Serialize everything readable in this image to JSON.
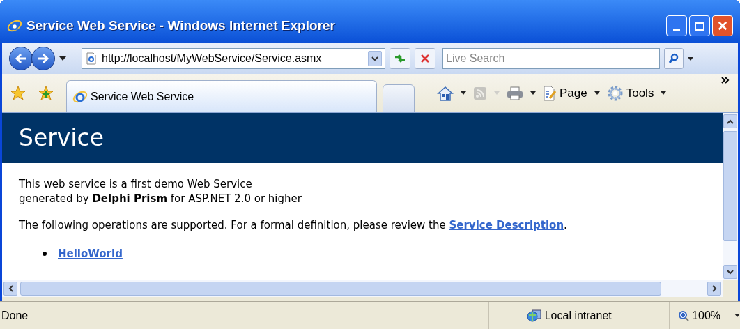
{
  "window": {
    "title": "Service Web Service - Windows Internet Explorer"
  },
  "address": {
    "url": "http://localhost/MyWebService/Service.asmx"
  },
  "search": {
    "placeholder": "Live Search"
  },
  "tabs": [
    {
      "label": "Service Web Service",
      "selected": true
    }
  ],
  "toolbar": [
    {
      "kind": "home",
      "disabled": false
    },
    {
      "kind": "feeds",
      "disabled": true
    },
    {
      "kind": "print",
      "disabled": false
    },
    {
      "kind": "page",
      "label": "Page",
      "disabled": false
    },
    {
      "kind": "tools",
      "label": "Tools",
      "disabled": false
    }
  ],
  "page": {
    "heading": "Service",
    "intro": [
      "This web service is a first demo Web Service",
      "generated by **Delphi Prism** for ASP.NET 2.0 or higher"
    ],
    "operations_text": "The following operations are supported. For a formal definition, please review the",
    "description_link": "Service Description",
    "operations_end": ".",
    "operations": [
      "HelloWorld"
    ]
  },
  "status_bar": {
    "text": "Done",
    "zone": "Local intranet",
    "zoom": "100%"
  }
}
